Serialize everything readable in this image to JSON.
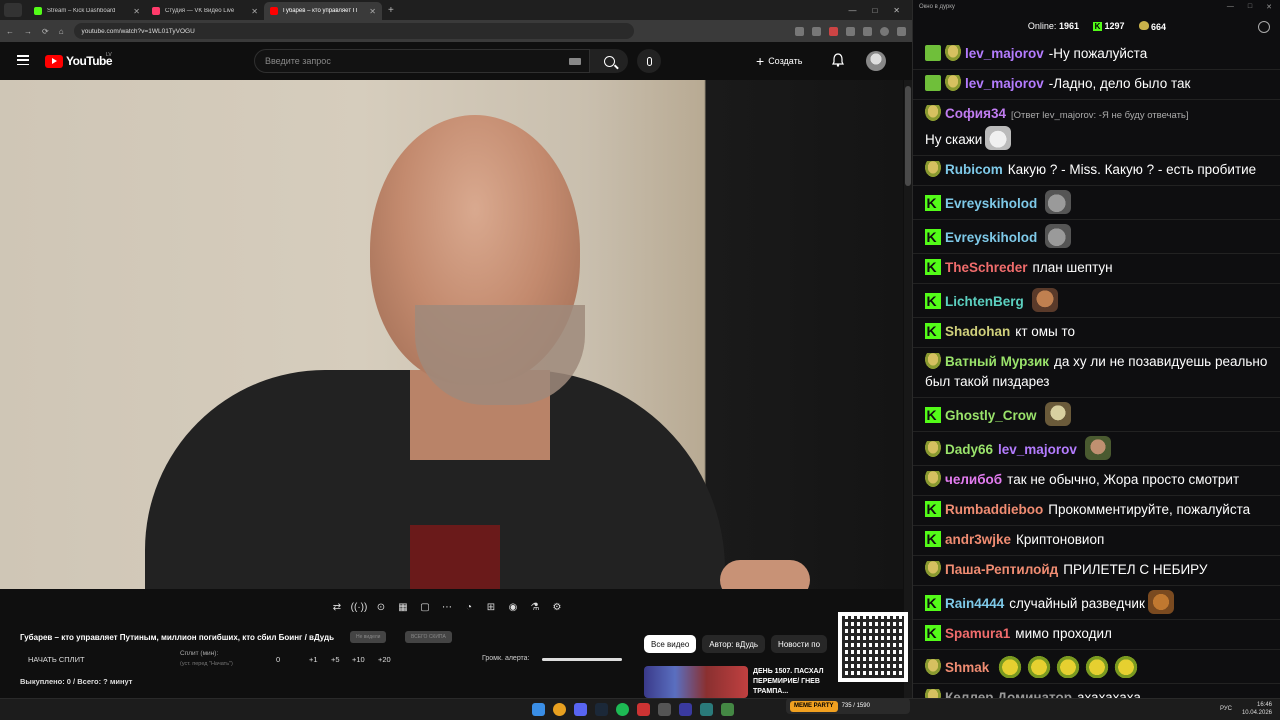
{
  "browser": {
    "tabs": [
      {
        "title": "Stream – Kick Dashboard",
        "favicon_color": "#53fc18",
        "active": false
      },
      {
        "title": "Студия — VK Видео Live",
        "favicon_color": "#ff3b6b",
        "active": false
      },
      {
        "title": "Губарев – кто управляет П",
        "favicon_color": "#ff0000",
        "active": true
      }
    ],
    "new_tab": "+",
    "window_controls": [
      "—",
      "□",
      "✕"
    ],
    "url": "youtube.com/watch?v=1WL01TyVOGU",
    "nav": [
      "←",
      "→",
      "⟳",
      "⌂"
    ]
  },
  "youtube": {
    "logo_text": "YouTube",
    "region": "LV",
    "search_placeholder": "Введите запрос",
    "create_label": "Создать"
  },
  "player_controls": [
    "⇄",
    "((·))",
    "⊙",
    "▦",
    "▢",
    "⋯",
    "◔",
    "⊞",
    "◉",
    "⚗",
    "⚙"
  ],
  "panel": {
    "video_title": "Губарев – кто управляет Путиным, миллион погибших, кто сбил Боинг / вДудь",
    "chip1": "Не видели",
    "chip2": "ВСЕГО СКИПА",
    "split_start": "НАЧАТЬ СПЛИТ",
    "split_label": "Сплит (мин):",
    "split_hint": "(уст. перед \"Начать\")",
    "split_values": [
      "0",
      "+1",
      "+5",
      "+10",
      "+20"
    ],
    "alert_label": "Громк. алерта:",
    "alert_level": 1.0,
    "bought": "Выкуплено: 0 / Всего: ? минут"
  },
  "filters": [
    "Все видео",
    "Автор: вДудь",
    "Новости по"
  ],
  "recommendation": {
    "title": "ДЕНЬ 1507. ПАСХАЛ ПЕРЕМИРИЕ/ ГНЕВ ТРАМПА..."
  },
  "chat": {
    "window_title": "Окно в дурку",
    "online_label": "Online:",
    "online_count": "1961",
    "kick_count": "1297",
    "frog_count": "664",
    "messages": [
      {
        "badge": "check2",
        "user": "lev_majorov",
        "color": "c-violet",
        "text": "-Ну пожалуйста"
      },
      {
        "badge": "check2",
        "user": "lev_majorov",
        "color": "c-violet",
        "text": "-Ладно, дело было так"
      },
      {
        "badge": "frog",
        "user": "София34",
        "color": "c-purple",
        "reply": "[Ответ lev_majorov: -Я не буду отвечать]",
        "text": "Ну скажи",
        "emote": "e-cat"
      },
      {
        "badge": "frog",
        "user": "Rubicom",
        "color": "c-cyan",
        "text": "Какую ? -  Miss.    Какую ? - есть пробитие"
      },
      {
        "badge": "kick",
        "user": "Evreyskiholod",
        "color": "c-cyan",
        "text": "",
        "emote": "e-seal"
      },
      {
        "badge": "kick",
        "user": "Evreyskiholod",
        "color": "c-cyan",
        "text": "",
        "emote": "e-seal"
      },
      {
        "badge": "kick",
        "user": "TheSchreder",
        "color": "c-red",
        "text": "план шептун"
      },
      {
        "badge": "kick",
        "user": "LichtenBerg",
        "color": "c-teal",
        "text": "",
        "emote": "e-face"
      },
      {
        "badge": "kick",
        "user": "Shadohan",
        "color": "c-khaki",
        "text": "кт омы то"
      },
      {
        "badge": "frog",
        "user": "Ватный Мурзик",
        "color": "c-green",
        "text": "да ху ли не позавидуешь реально был такой пиздарез"
      },
      {
        "badge": "kick",
        "user": "Ghostly_Crow",
        "color": "c-green",
        "text": "",
        "emote": "e-pepe"
      },
      {
        "badge": "frog",
        "user": "Dady66",
        "color": "c-green",
        "text": "",
        "mention": "lev_majorov",
        "emote": "e-army"
      },
      {
        "badge": "frog",
        "user": "челибоб",
        "color": "c-magenta",
        "text": "так не обычно, Жора просто смотрит"
      },
      {
        "badge": "kick",
        "user": "Rumbaddieboo",
        "color": "c-salmon",
        "text": "Прокомментируйте, пожалуйста"
      },
      {
        "badge": "kick",
        "user": "andr3wjke",
        "color": "c-salmon",
        "text": "Криптоновиоп"
      },
      {
        "badge": "frog",
        "user": "Паша-Рептилойд",
        "color": "c-salmon",
        "text": "ПРИЛЕТЕЛ С НЕБИРУ"
      },
      {
        "badge": "kick",
        "user": "Rain4444",
        "color": "c-cyan",
        "text": "случайный разведчик",
        "emote": "e-dog"
      },
      {
        "badge": "kick",
        "user": "Spamura1",
        "color": "c-red",
        "text": "мимо проходил"
      },
      {
        "badge": "frog",
        "user": "Shmak",
        "color": "c-salmon",
        "text": "",
        "emote_row": 5
      },
      {
        "badge": "frog",
        "user": "Келлер Доминатор",
        "color": "c-gray",
        "text": "ахахахаха"
      }
    ]
  },
  "taskbar": {
    "meme_label": "MEME PARTY",
    "meme_progress": "735 / 1590",
    "lang": "РУС",
    "time": "16:46",
    "date": "10.04.2026"
  }
}
